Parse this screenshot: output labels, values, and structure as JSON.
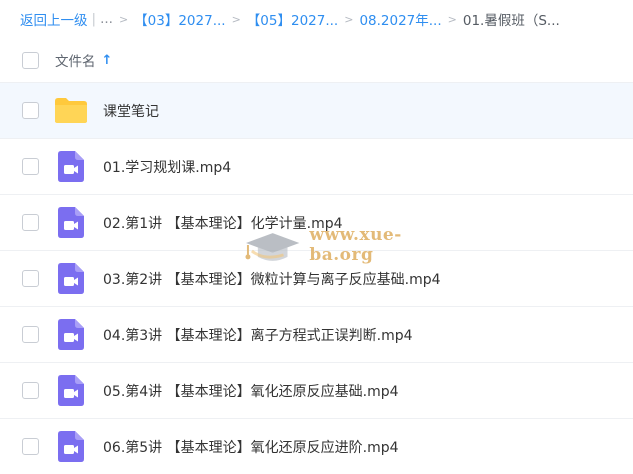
{
  "breadcrumb": {
    "back": "返回上一级",
    "ellipsis": "...",
    "items": [
      "【03】2027...",
      "【05】2027...",
      "08.2027年..."
    ],
    "current": "01.暑假班（S..."
  },
  "header": {
    "name_column": "文件名",
    "sort_icon": "arrow-up-icon"
  },
  "files": [
    {
      "name": "课堂笔记",
      "type": "folder"
    },
    {
      "name": "01.学习规划课.mp4",
      "type": "video"
    },
    {
      "name": "02.第1讲 【基本理论】化学计量.mp4",
      "type": "video"
    },
    {
      "name": "03.第2讲 【基本理论】微粒计算与离子反应基础.mp4",
      "type": "video"
    },
    {
      "name": "04.第3讲 【基本理论】离子方程式正误判断.mp4",
      "type": "video"
    },
    {
      "name": "05.第4讲 【基本理论】氧化还原反应基础.mp4",
      "type": "video"
    },
    {
      "name": "06.第5讲 【基本理论】氧化还原反应进阶.mp4",
      "type": "video"
    }
  ],
  "watermark": "www.xue-ba.org",
  "colors": {
    "accent": "#2f8ef0",
    "folder": "#ffd04b",
    "video": "#7b6ef0",
    "highlight_row": "#f3f8fe"
  }
}
